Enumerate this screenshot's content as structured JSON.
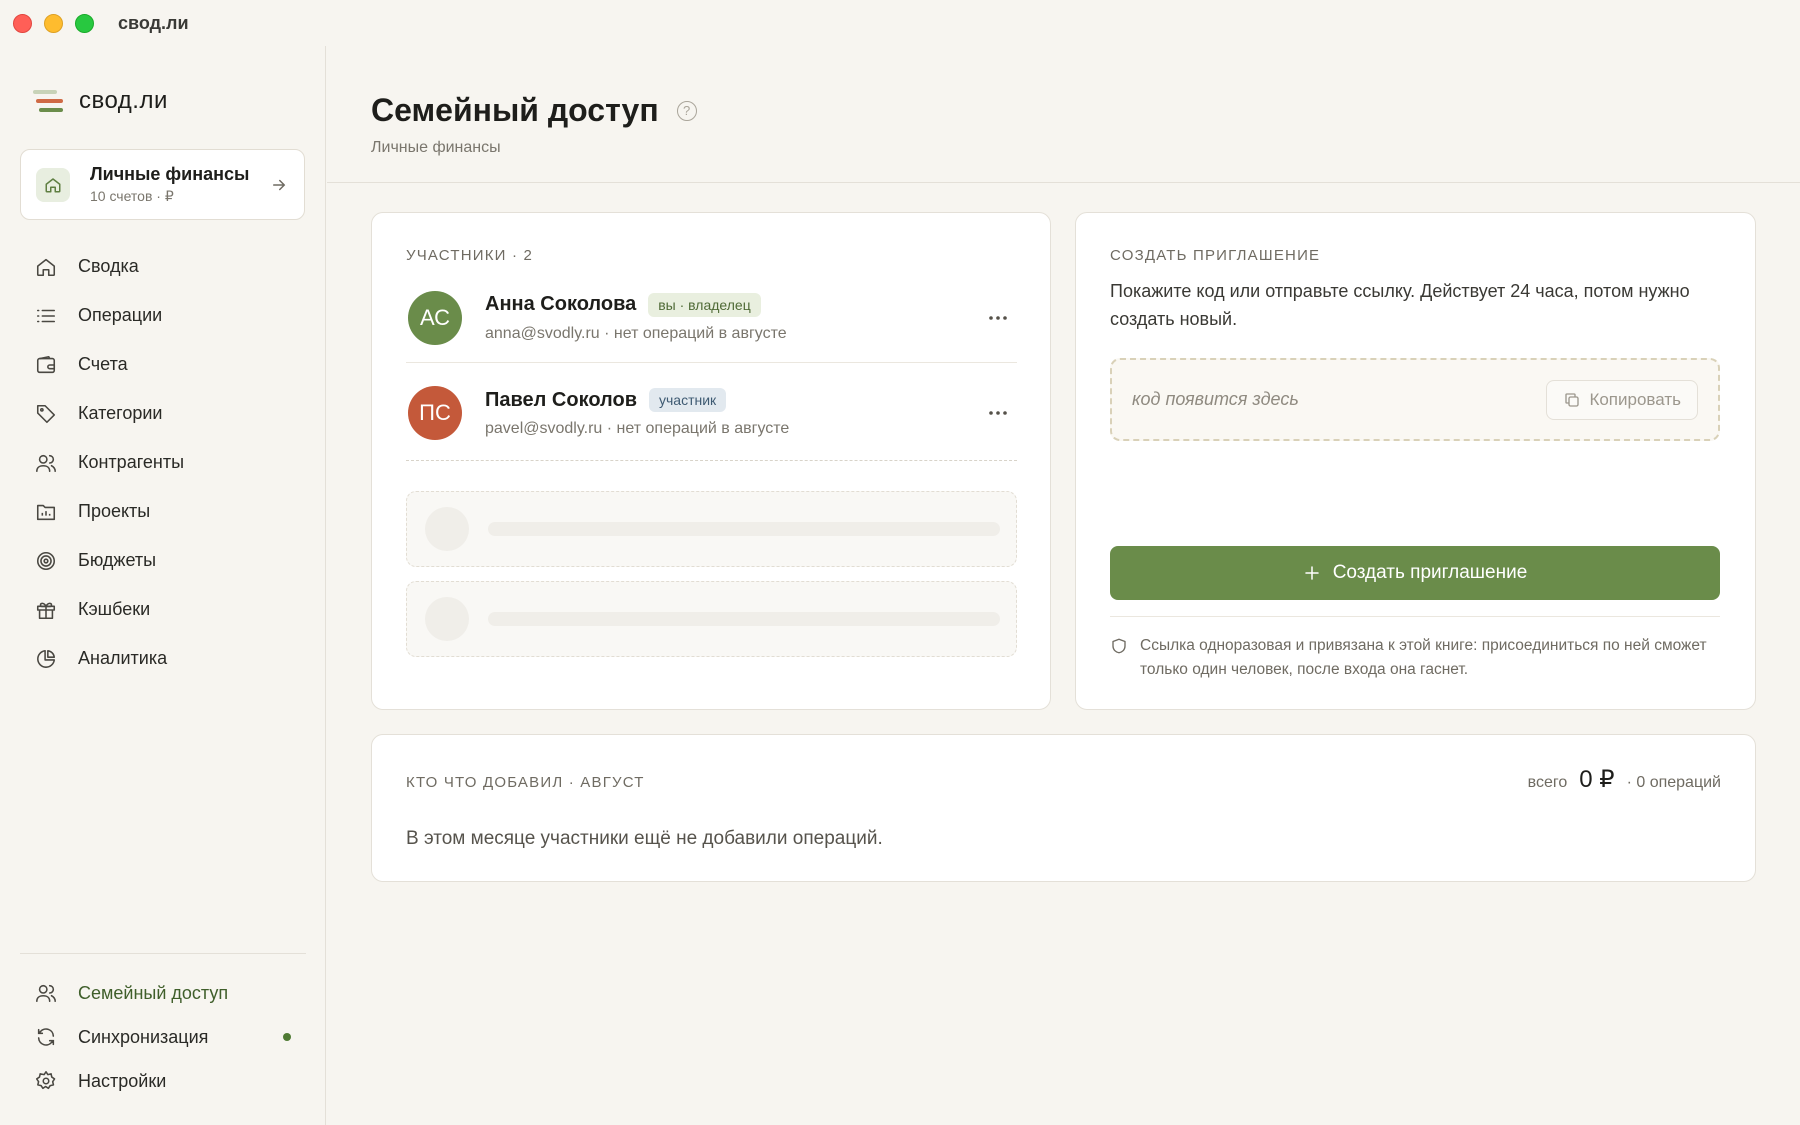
{
  "window": {
    "title": "свод.ли"
  },
  "sidebar": {
    "brand": "свод.ли",
    "book": {
      "title": "Личные финансы",
      "subtitle": "10 счетов · ₽"
    },
    "items": [
      {
        "label": "Сводка",
        "icon": "home-icon"
      },
      {
        "label": "Операции",
        "icon": "list-icon"
      },
      {
        "label": "Счета",
        "icon": "wallet-icon"
      },
      {
        "label": "Категории",
        "icon": "tag-icon"
      },
      {
        "label": "Контрагенты",
        "icon": "users-icon"
      },
      {
        "label": "Проекты",
        "icon": "folder-chart-icon"
      },
      {
        "label": "Бюджеты",
        "icon": "target-icon"
      },
      {
        "label": "Кэшбеки",
        "icon": "gift-icon"
      },
      {
        "label": "Аналитика",
        "icon": "pie-chart-icon"
      }
    ],
    "bottom_items": [
      {
        "label": "Семейный доступ",
        "icon": "users-icon",
        "active": true
      },
      {
        "label": "Синхронизация",
        "icon": "sync-icon"
      },
      {
        "label": "Настройки",
        "icon": "gear-icon"
      }
    ]
  },
  "page": {
    "title": "Семейный доступ",
    "subtitle": "Личные финансы"
  },
  "members": {
    "label": "УЧАСТНИКИ · 2",
    "list": [
      {
        "initials": "АС",
        "name": "Анна Соколова",
        "badge": "вы · владелец",
        "meta": "anna@svodly.ru · нет операций в августе",
        "color": "#6a8c4a"
      },
      {
        "initials": "ПС",
        "name": "Павел Соколов",
        "badge": "участник",
        "meta": "pavel@svodly.ru · нет операций в августе",
        "color": "#c4593a"
      }
    ]
  },
  "invite": {
    "label": "СОЗДАТЬ ПРИГЛАШЕНИЕ",
    "description": "Покажите код или отправьте ссылку. Действует 24 часа, потом нужно создать новый.",
    "code_placeholder": "код появится здесь",
    "copy_label": "Копировать",
    "create_label": "Создать приглашение",
    "note": "Ссылка одноразовая и привязана к этой книге: присоединиться по ней сможет только один человек, после входа она гаснет."
  },
  "activity": {
    "label": "КТО ЧТО ДОБАВИЛ · АВГУСТ",
    "total_prefix": "всего",
    "total_value": "0 ₽",
    "total_suffix": "· 0 операций",
    "empty_text": "В этом месяце участники ещё не добавили операций."
  },
  "colors": {
    "accent": "#6a8c4a",
    "owner_badge_bg": "#e9efdf",
    "member_badge_bg": "#e2e9ef",
    "sync_dot": "#4f7a33"
  }
}
